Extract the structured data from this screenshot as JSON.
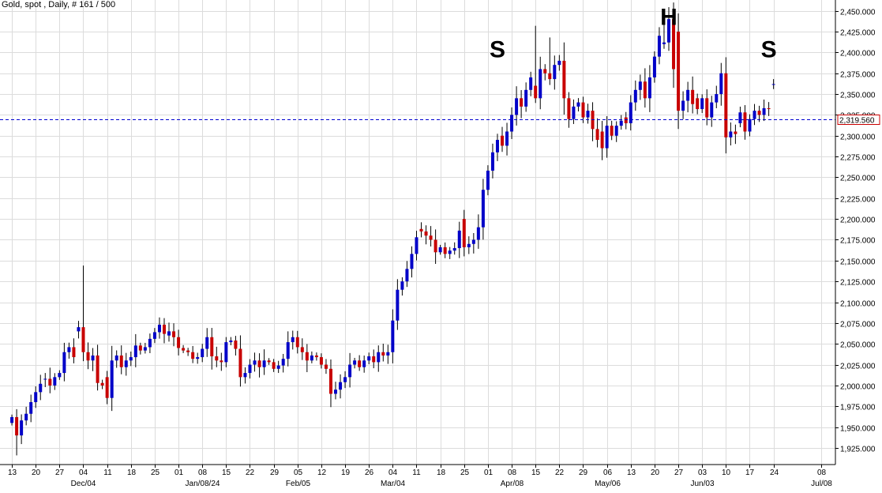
{
  "header": {
    "title": "Gold, spot , Daily, # 161 / 500"
  },
  "chart_data": {
    "type": "candlestick",
    "title": "Gold, spot , Daily, # 161 / 500",
    "x_ticks": [
      {
        "i": 0,
        "label": "13"
      },
      {
        "i": 5,
        "label": "20"
      },
      {
        "i": 10,
        "label": "27"
      },
      {
        "i": 15,
        "label": "04",
        "month": "Dec/04"
      },
      {
        "i": 20,
        "label": "11"
      },
      {
        "i": 25,
        "label": "18"
      },
      {
        "i": 30,
        "label": "25"
      },
      {
        "i": 35,
        "label": "01"
      },
      {
        "i": 40,
        "label": "08",
        "month": "Jan/08/24"
      },
      {
        "i": 45,
        "label": "15"
      },
      {
        "i": 50,
        "label": "22"
      },
      {
        "i": 55,
        "label": "29"
      },
      {
        "i": 60,
        "label": "05",
        "month": "Feb/05"
      },
      {
        "i": 65,
        "label": "12"
      },
      {
        "i": 70,
        "label": "19"
      },
      {
        "i": 75,
        "label": "26"
      },
      {
        "i": 80,
        "label": "04",
        "month": "Mar/04"
      },
      {
        "i": 85,
        "label": "11"
      },
      {
        "i": 90,
        "label": "18"
      },
      {
        "i": 95,
        "label": "25"
      },
      {
        "i": 100,
        "label": "01"
      },
      {
        "i": 105,
        "label": "08",
        "month": "Apr/08"
      },
      {
        "i": 110,
        "label": "15"
      },
      {
        "i": 115,
        "label": "22"
      },
      {
        "i": 120,
        "label": "29"
      },
      {
        "i": 125,
        "label": "06",
        "month": "May/06"
      },
      {
        "i": 130,
        "label": "13"
      },
      {
        "i": 135,
        "label": "20"
      },
      {
        "i": 140,
        "label": "27"
      },
      {
        "i": 145,
        "label": "03",
        "month": "Jun/03"
      },
      {
        "i": 150,
        "label": "10"
      },
      {
        "i": 155,
        "label": "17"
      },
      {
        "i": 160,
        "label": "24"
      },
      {
        "i": 170,
        "label": "08",
        "month": "Jul/08"
      }
    ],
    "y_ticks": [
      "1,925.000",
      "1,950.000",
      "1,975.000",
      "2,000.000",
      "2,025.000",
      "2,050.000",
      "2,075.000",
      "2,100.000",
      "2,125.000",
      "2,150.000",
      "2,175.000",
      "2,200.000",
      "2,225.000",
      "2,250.000",
      "2,275.000",
      "2,300.000",
      "2,325.000",
      "2,350.000",
      "2,375.000",
      "2,400.000",
      "2,425.000",
      "2,450.000"
    ],
    "y_tick_values": [
      1925,
      1950,
      1975,
      2000,
      2025,
      2050,
      2075,
      2100,
      2125,
      2150,
      2175,
      2200,
      2225,
      2250,
      2275,
      2300,
      2325,
      2350,
      2375,
      2400,
      2425,
      2450
    ],
    "ylim": [
      1905,
      2463
    ],
    "xlim": [
      -2.5,
      173
    ],
    "current_price": 2319.56,
    "current_price_label": "2,319.560",
    "annotations": [
      {
        "text": "S",
        "i": 102,
        "price": 2394
      },
      {
        "text": "H",
        "i": 138,
        "price": 2433
      },
      {
        "text": "S",
        "i": 159,
        "price": 2394
      }
    ],
    "up_color": "#0000c8",
    "down_color": "#c80000",
    "closes": [
      1962,
      1940,
      1958,
      1966,
      1980,
      1992,
      2002,
      2008,
      2000,
      2010,
      2015,
      2040,
      2046,
      2034,
      2070,
      2040,
      2030,
      2036,
      2003,
      2000,
      1985,
      2030,
      2036,
      2022,
      2030,
      2034,
      2048,
      2042,
      2046,
      2056,
      2064,
      2073,
      2062,
      2065,
      2058,
      2045,
      2042,
      2040,
      2032,
      2034,
      2044,
      2058,
      2035,
      2030,
      2028,
      2052,
      2054,
      2044,
      2010,
      2015,
      2025,
      2030,
      2022,
      2030,
      2028,
      2020,
      2024,
      2032,
      2052,
      2058,
      2046,
      2040,
      2030,
      2036,
      2034,
      2025,
      2020,
      1990,
      1995,
      2004,
      2010,
      2025,
      2030,
      2022,
      2030,
      2035,
      2028,
      2040,
      2036,
      2040,
      2078,
      2115,
      2125,
      2140,
      2158,
      2178,
      2185,
      2180,
      2175,
      2160,
      2166,
      2158,
      2162,
      2165,
      2186,
      2166,
      2170,
      2175,
      2190,
      2235,
      2258,
      2280,
      2295,
      2288,
      2305,
      2325,
      2345,
      2335,
      2355,
      2370,
      2345,
      2380,
      2375,
      2368,
      2385,
      2390,
      2345,
      2320,
      2335,
      2340,
      2322,
      2330,
      2308,
      2295,
      2285,
      2312,
      2300,
      2312,
      2318,
      2315,
      2340,
      2355,
      2365,
      2345,
      2370,
      2395,
      2420,
      2412,
      2440,
      2380,
      2330,
      2342,
      2355,
      2338,
      2332,
      2345,
      2322,
      2340,
      2350,
      2375,
      2298,
      2305,
      2302,
      2328,
      2305,
      2320,
      2330,
      2325,
      2333,
      2332,
      2362,
      2320
    ],
    "opens": [
      1955,
      1962,
      1940,
      1958,
      1966,
      1980,
      1992,
      2008,
      2008,
      2000,
      2010,
      2015,
      2040,
      2046,
      2065,
      2070,
      2040,
      2030,
      2036,
      2003,
      2010,
      1985,
      2030,
      2036,
      2022,
      2030,
      2034,
      2048,
      2042,
      2046,
      2056,
      2064,
      2073,
      2060,
      2065,
      2058,
      2045,
      2042,
      2040,
      2032,
      2034,
      2044,
      2058,
      2035,
      2030,
      2028,
      2052,
      2054,
      2044,
      2010,
      2015,
      2025,
      2030,
      2022,
      2030,
      2028,
      2020,
      2024,
      2032,
      2052,
      2058,
      2046,
      2040,
      2030,
      2036,
      2034,
      2025,
      2020,
      1990,
      1995,
      2004,
      2010,
      2025,
      2030,
      2022,
      2030,
      2035,
      2028,
      2040,
      2036,
      2040,
      2078,
      2115,
      2125,
      2140,
      2158,
      2188,
      2185,
      2180,
      2175,
      2160,
      2166,
      2158,
      2162,
      2165,
      2200,
      2166,
      2170,
      2175,
      2190,
      2235,
      2258,
      2280,
      2300,
      2288,
      2305,
      2325,
      2345,
      2335,
      2355,
      2360,
      2345,
      2380,
      2375,
      2368,
      2385,
      2390,
      2345,
      2320,
      2335,
      2340,
      2322,
      2330,
      2308,
      2305,
      2285,
      2312,
      2300,
      2312,
      2322,
      2315,
      2340,
      2355,
      2365,
      2345,
      2370,
      2395,
      2410,
      2412,
      2440,
      2425,
      2330,
      2342,
      2355,
      2345,
      2332,
      2345,
      2322,
      2340,
      2350,
      2375,
      2298,
      2305,
      2315,
      2328,
      2305,
      2320,
      2330,
      2325,
      2333,
      2362
    ]
  }
}
